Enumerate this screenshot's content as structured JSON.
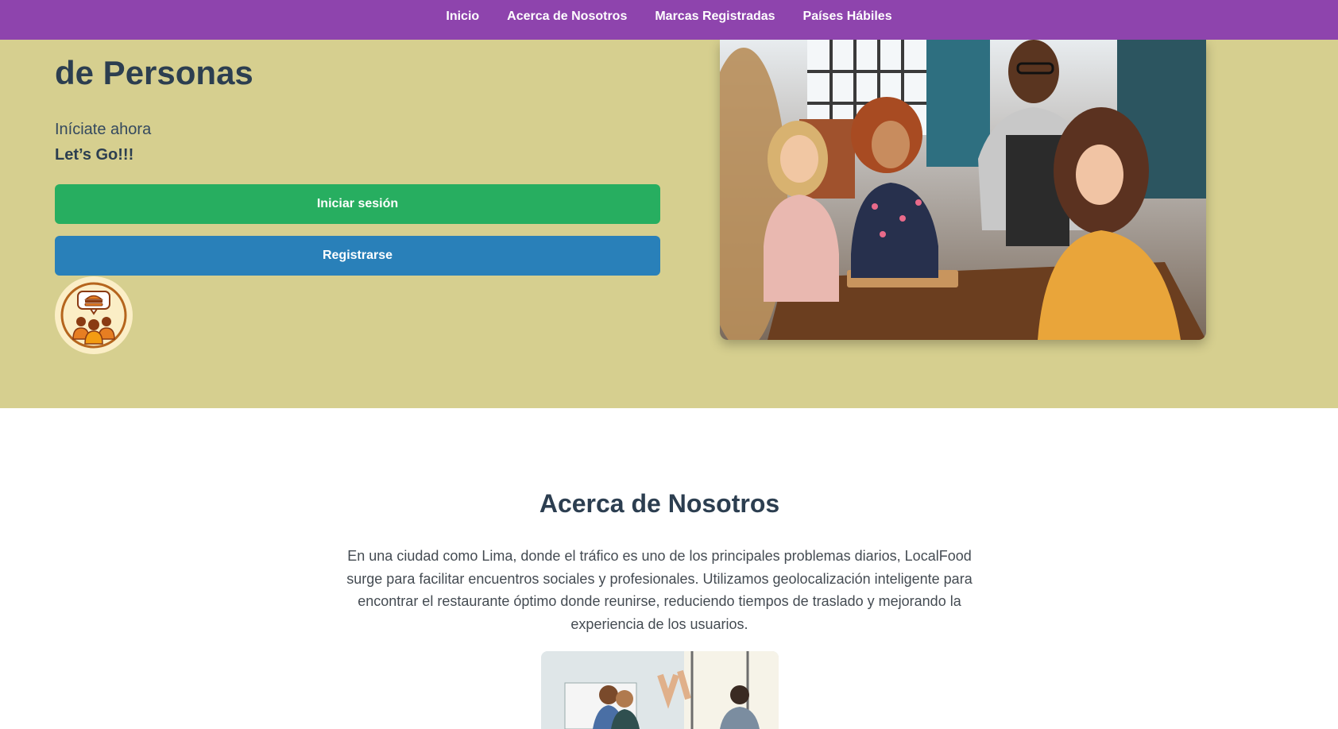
{
  "nav": {
    "items": [
      {
        "label": "Inicio"
      },
      {
        "label": "Acerca de Nosotros"
      },
      {
        "label": "Marcas Registradas"
      },
      {
        "label": "Países Hábiles"
      }
    ],
    "background": "#8e44ad"
  },
  "hero": {
    "title": "de Personas",
    "subtitle": "Iníciate ahora",
    "cta": "Let’s Go!!!",
    "login_label": "Iniciar sesión",
    "register_label": "Registrarse",
    "logo_icon": "group-dining-icon",
    "photo_icon": "restaurant-friends-photo",
    "background": "#d6cf8f"
  },
  "about": {
    "title": "Acerca de Nosotros",
    "text": "En una ciudad como Lima, donde el tráfico es uno de los principales problemas diarios, LocalFood surge para facilitar encuentros sociales y profesionales. Utilizamos geolocalización inteligente para encontrar el restaurante óptimo donde reunirse, reduciendo tiempos de traslado y mejorando la experiencia de los usuarios.",
    "photo_icon": "team-high-five-photo"
  },
  "colors": {
    "login_button": "#27ae60",
    "register_button": "#2980b9",
    "heading": "#2c3e50"
  }
}
